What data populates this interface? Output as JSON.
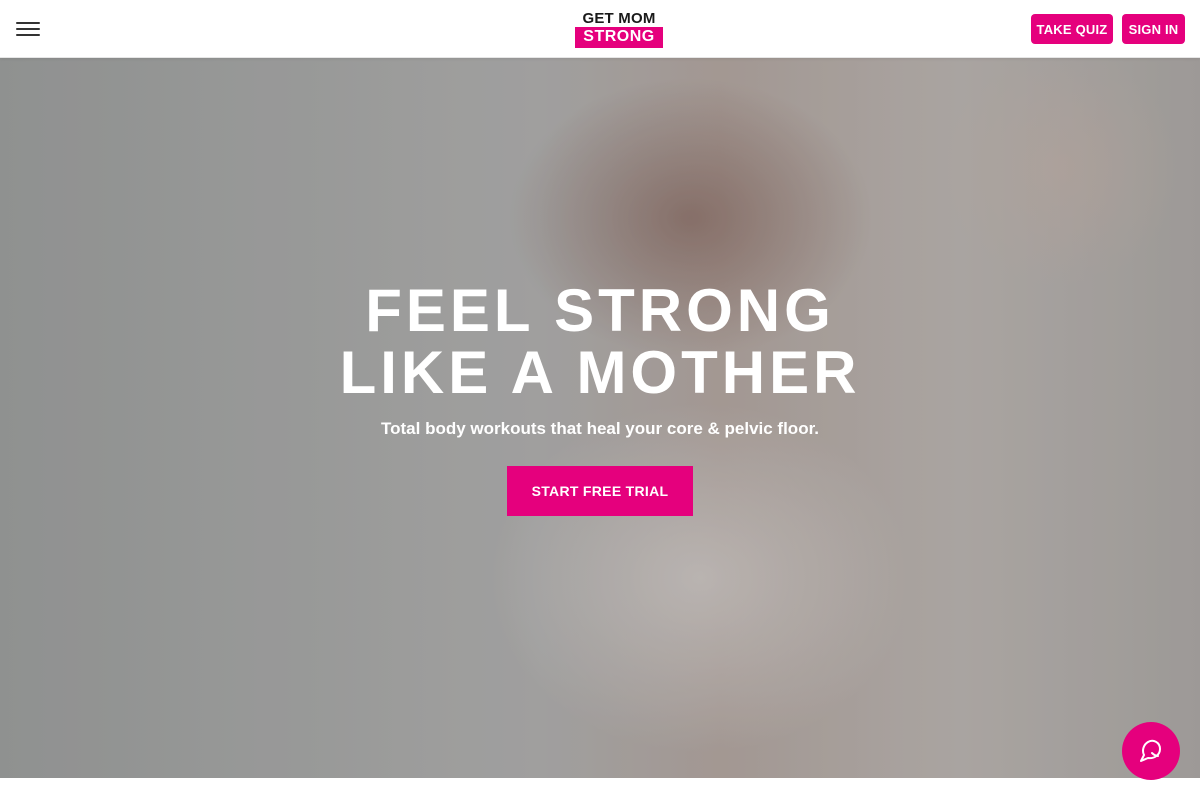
{
  "header": {
    "menu_icon": "hamburger-menu-icon",
    "logo": {
      "line1": "GET MOM",
      "line2": "STRONG"
    },
    "take_quiz_label": "TAKE QUIZ",
    "sign_in_label": "SIGN IN"
  },
  "hero": {
    "title_line1": "FEEL STRONG",
    "title_line2": "LIKE A MOTHER",
    "subtitle": "Total body workouts that heal your core & pelvic floor.",
    "cta_label": "START FREE TRIAL"
  },
  "chat": {
    "icon": "chat-icon"
  },
  "colors": {
    "accent": "#e5007d",
    "text_dark": "#1a1a1a",
    "header_bg": "#ffffff"
  }
}
